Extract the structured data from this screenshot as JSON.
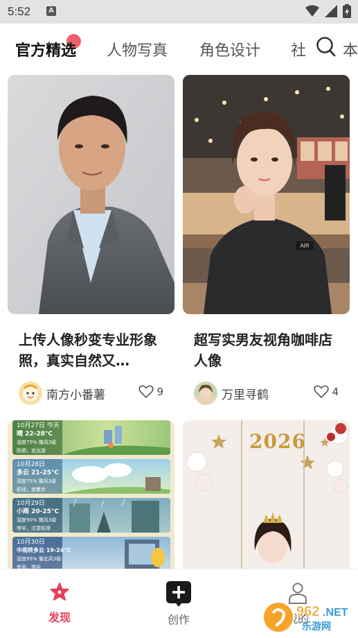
{
  "status_bar": {
    "time": "5:52",
    "notif_glyph": "A"
  },
  "tabs": [
    {
      "label": "官方精选",
      "active": true
    },
    {
      "label": "人物写真",
      "active": false
    },
    {
      "label": "角色设计",
      "active": false
    },
    {
      "label": "社",
      "active": false
    },
    {
      "label": "本",
      "active": false
    }
  ],
  "cards": [
    {
      "title": "上传人像秒变专业形象照，真实自然又…",
      "author": "南方小番薯",
      "likes": "9"
    },
    {
      "title": "超写实男友视角咖啡店人像",
      "author": "万里寻鹤",
      "likes": "4"
    }
  ],
  "weather_card": {
    "days": [
      {
        "date": "10月27日 今天",
        "weather": "晴  22-28°C",
        "detail": "湿度75%  微风3级",
        "note": "防晒，宜出游"
      },
      {
        "date": "10月28日",
        "weather": "多云  21-25°C",
        "detail": "湿度75%  微风3级",
        "note": "舒适，宜散步"
      },
      {
        "date": "10月29日",
        "weather": "小雨  20-25°C",
        "detail": "湿度90%  微风3级",
        "note": "带伞，注意防滑"
      },
      {
        "date": "10月30日",
        "weather": "中雨转多云  19-24°C",
        "detail": "湿度95%  偏北风3级",
        "note": "有雨，带伞"
      }
    ]
  },
  "newyear_card": {
    "year_text": "2026"
  },
  "bottom_nav": [
    {
      "label": "发现",
      "active": true
    },
    {
      "label": "创作",
      "active": false
    },
    {
      "label": "我的",
      "active": false
    }
  ],
  "watermark": {
    "brand": "962",
    "domain": ".NET",
    "sub": "乐游网"
  },
  "colors": {
    "accent": "#f0606f",
    "nav_active": "#e8405a",
    "nav_inactive": "#666666"
  }
}
